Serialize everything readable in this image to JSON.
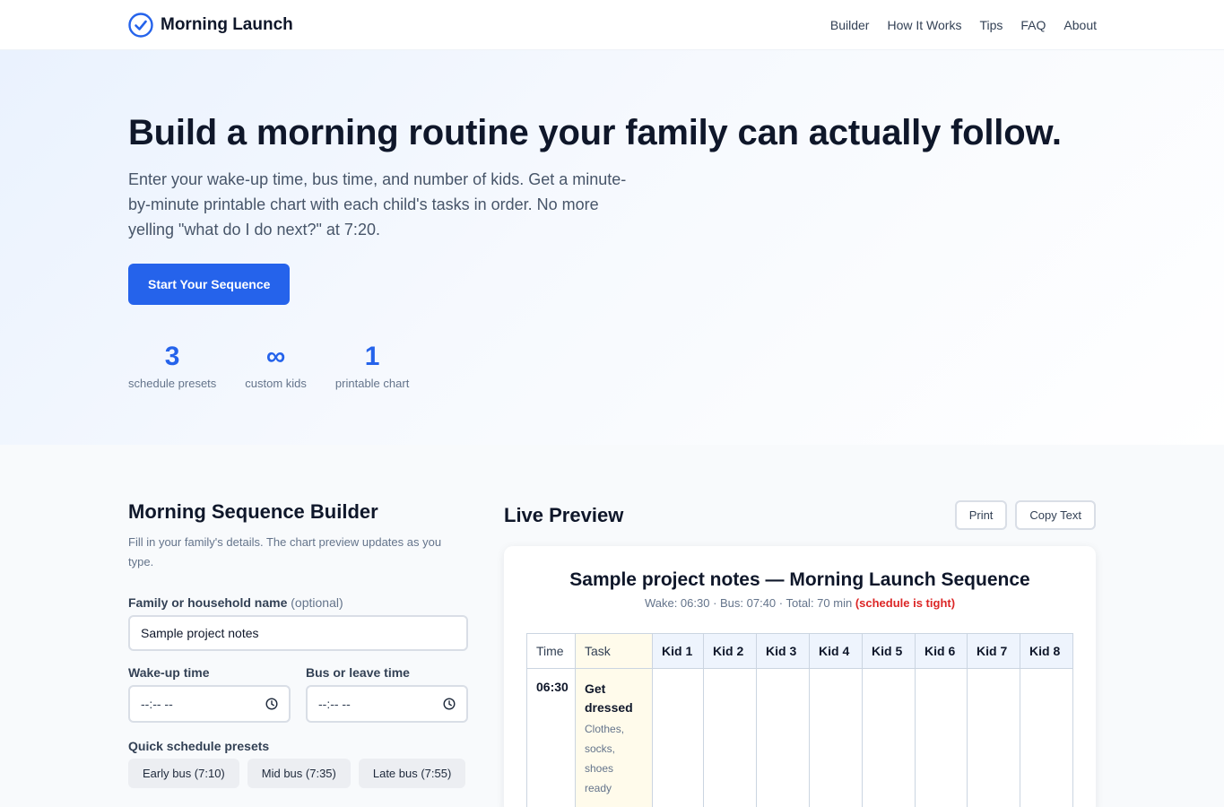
{
  "nav": {
    "brand": "Morning Launch",
    "links": [
      "Builder",
      "How It Works",
      "Tips",
      "FAQ",
      "About"
    ]
  },
  "hero": {
    "title": "Build a morning routine your family can actually follow.",
    "subtitle": "Enter your wake-up time, bus time, and number of kids. Get a minute-by-minute printable chart with each child's tasks in order. No more yelling \"what do I do next?\" at 7:20.",
    "cta": "Start Your Sequence",
    "stats": [
      {
        "value": "3",
        "label": "schedule presets"
      },
      {
        "value": "∞",
        "label": "custom kids"
      },
      {
        "value": "1",
        "label": "printable chart"
      }
    ]
  },
  "builder": {
    "title": "Morning Sequence Builder",
    "description": "Fill in your family's details. The chart preview updates as you type.",
    "family_label": "Family or household name",
    "family_optional": "(optional)",
    "family_value": "Sample project notes",
    "wake_label": "Wake-up time",
    "wake_value": "--:-- --",
    "bus_label": "Bus or leave time",
    "bus_value": "--:-- --",
    "presets_label": "Quick schedule presets",
    "presets": [
      "Early bus (7:10)",
      "Mid bus (7:35)",
      "Late bus (7:55)"
    ]
  },
  "preview": {
    "title": "Live Preview",
    "print_label": "Print",
    "copy_label": "Copy Text",
    "chart_title": "Sample project notes — Morning Launch Sequence",
    "meta": "Wake: 06:30 · Bus: 07:40 · Total: 70 min",
    "warning": "(schedule is tight)",
    "table": {
      "time_header": "Time",
      "task_header": "Task",
      "kids": [
        "Kid 1",
        "Kid 2",
        "Kid 3",
        "Kid 4",
        "Kid 5",
        "Kid 6",
        "Kid 7",
        "Kid 8"
      ],
      "rows": [
        {
          "time": "06:30",
          "task": "Get dressed",
          "detail": "Clothes, socks, shoes ready"
        }
      ]
    }
  },
  "colors": {
    "accent": "#2563eb",
    "warning": "#dc2626",
    "task_column": "#fffbeb",
    "kid_header": "#eef4fd"
  },
  "icons": [
    "check-circle-icon",
    "clock-icon"
  ]
}
